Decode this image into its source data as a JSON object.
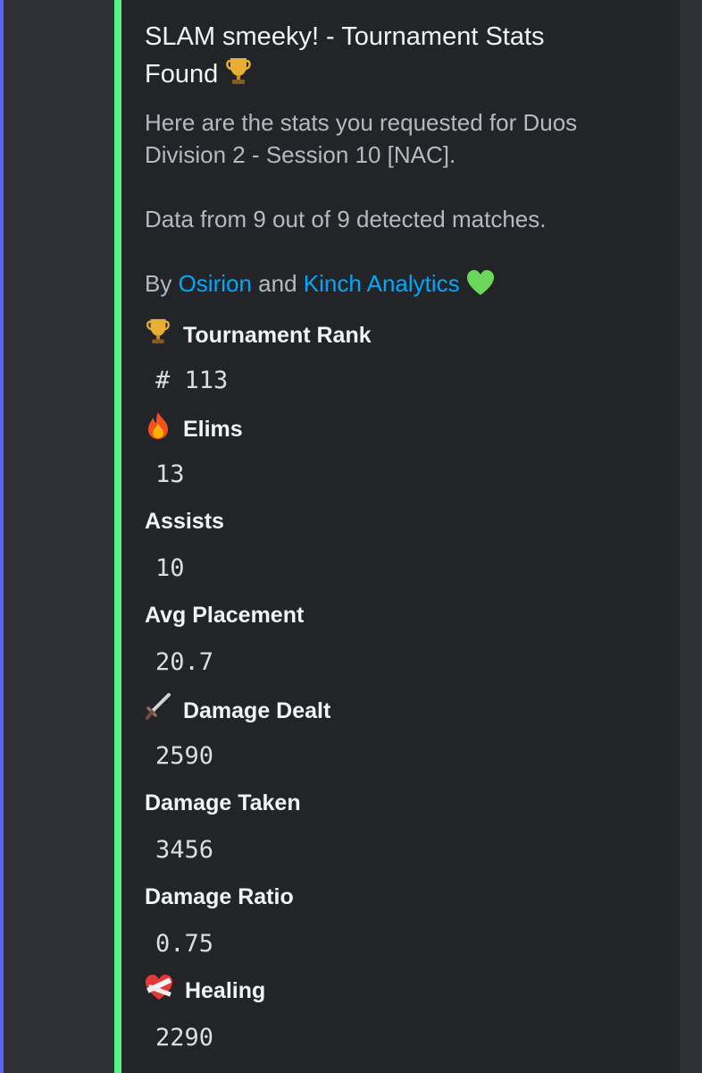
{
  "colors": {
    "page_bg": "#2f3035",
    "embed_bg": "#232428",
    "embed_border": "#57f287",
    "left_accent": "#5865f2",
    "link": "#00a8fc"
  },
  "embed": {
    "title_line1": "SLAM smeeky! - Tournament Stats",
    "title_line2": "Found",
    "title_icon": "trophy-icon",
    "description_line1": "Here are the stats you requested for Duos",
    "description_line2": "Division 2 - Session 10 [NAC].",
    "data_line": "Data from 9 out of 9 detected matches.",
    "credits": {
      "by": "By",
      "link1": "Osirion",
      "and": "and",
      "link2": "Kinch Analytics",
      "heart_icon": "green-heart-icon"
    }
  },
  "fields": [
    {
      "icon": "trophy-icon",
      "name": "Tournament Rank",
      "value": "# 113"
    },
    {
      "icon": "fire-icon",
      "name": "Elims",
      "value": "13"
    },
    {
      "icon": "",
      "name": "Assists",
      "value": "10"
    },
    {
      "icon": "",
      "name": "Avg Placement",
      "value": "20.7"
    },
    {
      "icon": "dagger-icon",
      "name": "Damage Dealt",
      "value": "2590"
    },
    {
      "icon": "",
      "name": "Damage Taken",
      "value": "3456"
    },
    {
      "icon": "",
      "name": "Damage Ratio",
      "value": "0.75"
    },
    {
      "icon": "bandaged-heart-icon",
      "name": "Healing",
      "value": "2290"
    }
  ]
}
